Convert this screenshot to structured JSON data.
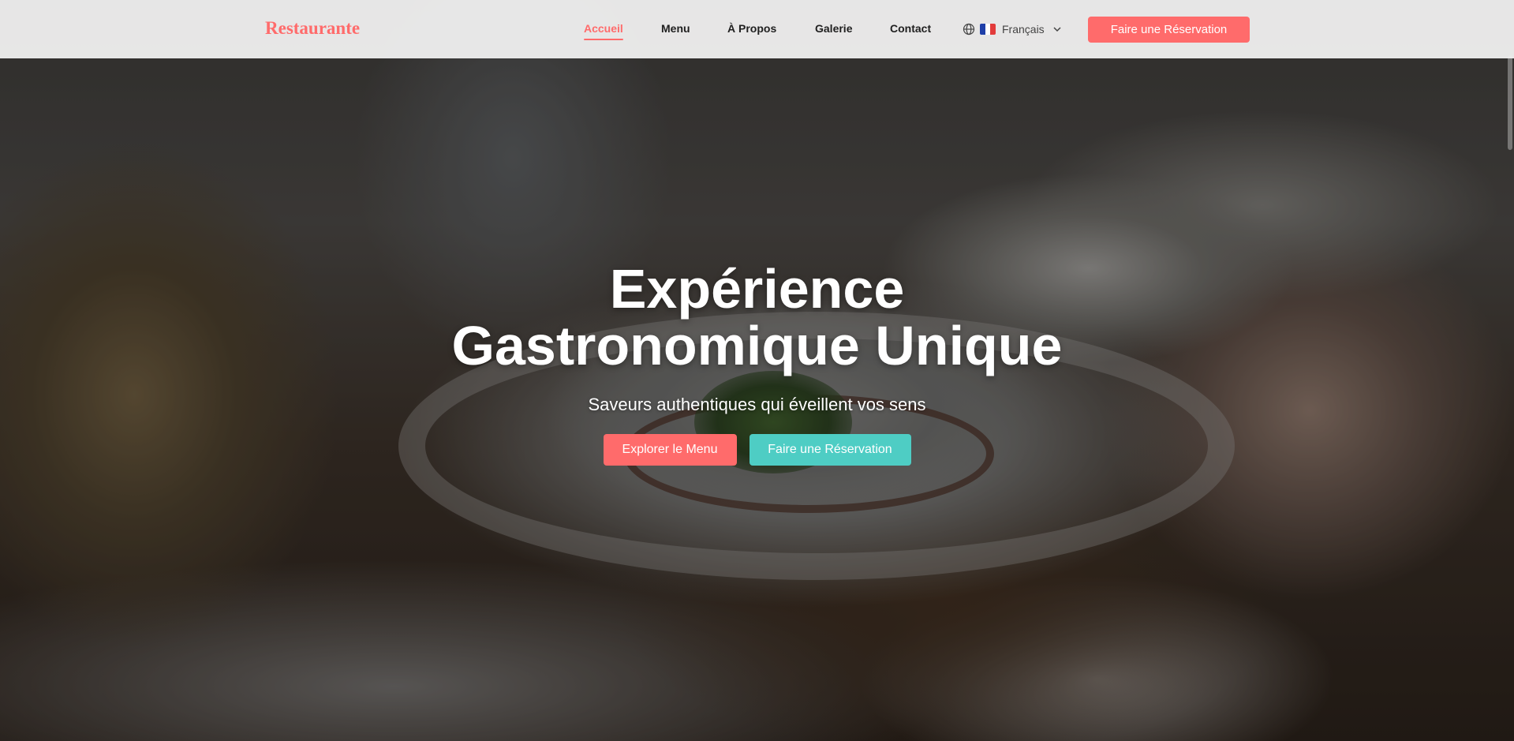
{
  "brand": {
    "logo_text": "Restaurante",
    "accent_color": "#ff6b6b",
    "secondary_color": "#4ecdc4"
  },
  "nav": {
    "items": [
      {
        "label": "Accueil",
        "active": true
      },
      {
        "label": "Menu",
        "active": false
      },
      {
        "label": "À Propos",
        "active": false
      },
      {
        "label": "Galerie",
        "active": false
      },
      {
        "label": "Contact",
        "active": false
      }
    ],
    "language": {
      "label": "Français",
      "icon": "globe-icon",
      "flag": "france-flag",
      "dropdown_icon": "chevron-down-icon"
    },
    "cta_label": "Faire une Réservation"
  },
  "hero": {
    "title_line1": "Expérience",
    "title_line2": "Gastronomique Unique",
    "subtitle": "Saveurs authentiques qui éveillent vos sens",
    "primary_button": "Explorer le Menu",
    "secondary_button": "Faire une Réservation"
  }
}
